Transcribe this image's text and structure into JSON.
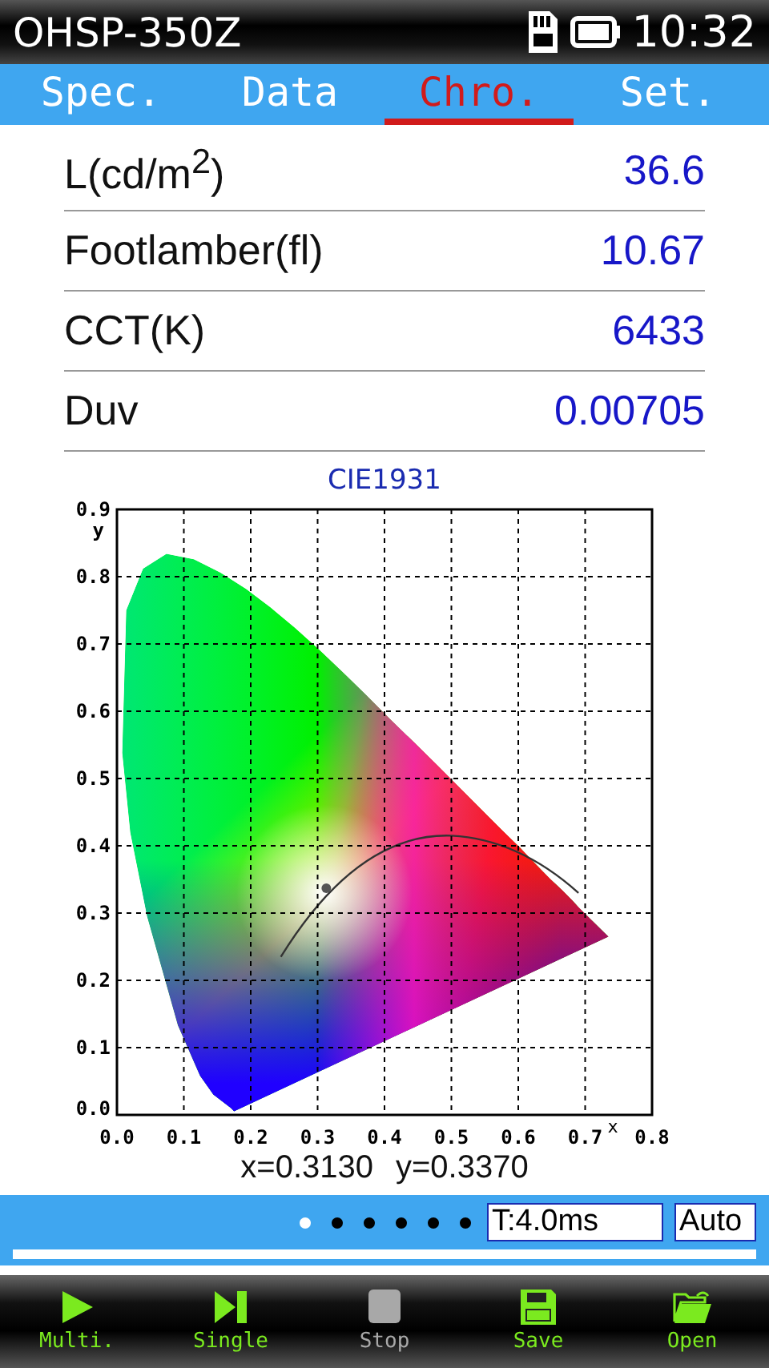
{
  "header": {
    "model": "OHSP-350Z",
    "time": "10:32"
  },
  "tabs": [
    {
      "label": "Spec.",
      "selected": false
    },
    {
      "label": "Data",
      "selected": false
    },
    {
      "label": "Chro.",
      "selected": true
    },
    {
      "label": "Set.",
      "selected": false
    }
  ],
  "readings": [
    {
      "label": "L(cd/m$^{2}$)",
      "value": "36.6"
    },
    {
      "label": "Footlamber(fl)",
      "value": "10.67"
    },
    {
      "label": "CCT(K)",
      "value": "6433"
    },
    {
      "label": "Duv",
      "value": "0.00705"
    }
  ],
  "chart": {
    "chart_data": {
      "type": "scatter",
      "title": "CIE1931",
      "xlabel": "x",
      "ylabel": "y",
      "xlim": [
        0,
        0.8
      ],
      "ylim": [
        0,
        0.9
      ],
      "grid": true,
      "xticks": [
        {
          "value": 0,
          "label": "0.0"
        },
        0.1,
        0.2,
        0.3,
        0.4,
        0.5,
        0.6,
        0.7,
        0.8
      ],
      "yticks": [
        {
          "value": 0,
          "label": "0.0"
        },
        0.1,
        0.2,
        0.3,
        0.4,
        0.5,
        0.6,
        0.7,
        0.8,
        0.9
      ],
      "x": [
        0.313
      ],
      "series": [
        {
          "color": "#555555",
          "values": [
            0.337
          ]
        }
      ]
    }
  },
  "coordinates": {
    "x": "x=0.3130",
    "y": "y=0.3370"
  },
  "status": {
    "pages": [
      {
        "selected": true
      },
      {
        "selected": false
      },
      {
        "selected": false
      },
      {
        "selected": false
      },
      {
        "selected": false
      },
      {
        "selected": false
      }
    ],
    "exposure": "T:4.0ms",
    "mode": "Auto"
  },
  "toolbar": [
    {
      "kind": "play",
      "label": "Multi.",
      "disabled": false
    },
    {
      "kind": "next",
      "label": "Single",
      "disabled": false
    },
    {
      "kind": "stop",
      "label": "Stop",
      "disabled": true
    },
    {
      "kind": "save",
      "label": "Save",
      "disabled": false
    },
    {
      "kind": "open",
      "label": "Open",
      "disabled": false
    }
  ]
}
